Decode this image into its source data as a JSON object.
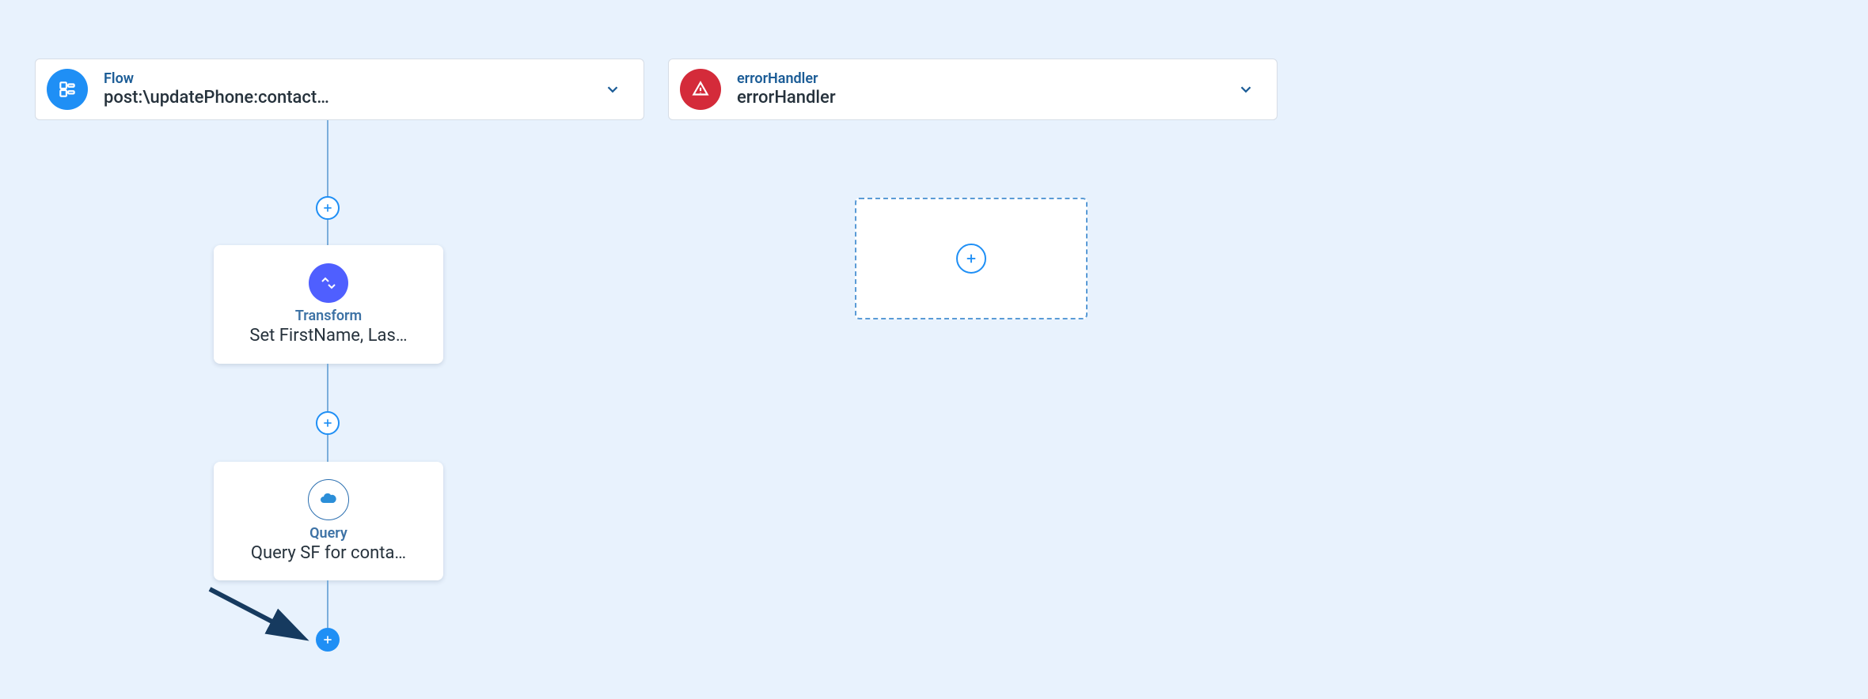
{
  "flowHeader": {
    "label": "Flow",
    "value": "post:\\updatePhone:contact…"
  },
  "errorHeader": {
    "label": "errorHandler",
    "value": "errorHandler"
  },
  "nodes": {
    "transform": {
      "type": "Transform",
      "label": "Set FirstName, Las…"
    },
    "query": {
      "type": "Query",
      "label": "Query SF for conta…"
    }
  }
}
